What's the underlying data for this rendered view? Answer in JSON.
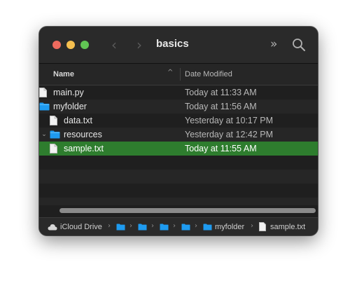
{
  "window": {
    "title": "basics",
    "nav_back_glyph": "‹",
    "nav_forward_glyph": "›",
    "more_glyph": "»",
    "icons": {
      "back": "chevron-left-icon",
      "forward": "chevron-right-icon",
      "more": "double-chevron-icon",
      "search": "search-icon"
    },
    "colors": {
      "close": "#ed6a5e",
      "minimize": "#f5bf4f",
      "maximize": "#61c554",
      "selection": "#2e7d2e",
      "folder": "#1e9bf0"
    }
  },
  "header": {
    "name_label": "Name",
    "date_label": "Date Modified",
    "sort_glyph": "^"
  },
  "rows": [
    {
      "name": "main.py",
      "date": "Today at 11:33 AM",
      "kind": "file",
      "indent": 0
    },
    {
      "name": "myfolder",
      "date": "Today at 11:56 AM",
      "kind": "folder",
      "indent": 0
    },
    {
      "name": "data.txt",
      "date": "Yesterday at 10:17 PM",
      "kind": "file",
      "indent": 1
    },
    {
      "name": "resources",
      "date": "Yesterday at 12:42 PM",
      "kind": "folder",
      "indent": 1,
      "expanded": true
    },
    {
      "name": "sample.txt",
      "date": "Today at 11:55 AM",
      "kind": "file",
      "indent": 2,
      "selected": true
    }
  ],
  "disclosure_glyph": "⌄",
  "pathbar": {
    "root": "iCloud Drive",
    "folder": "myfolder",
    "file": "sample.txt",
    "separator": "›"
  }
}
